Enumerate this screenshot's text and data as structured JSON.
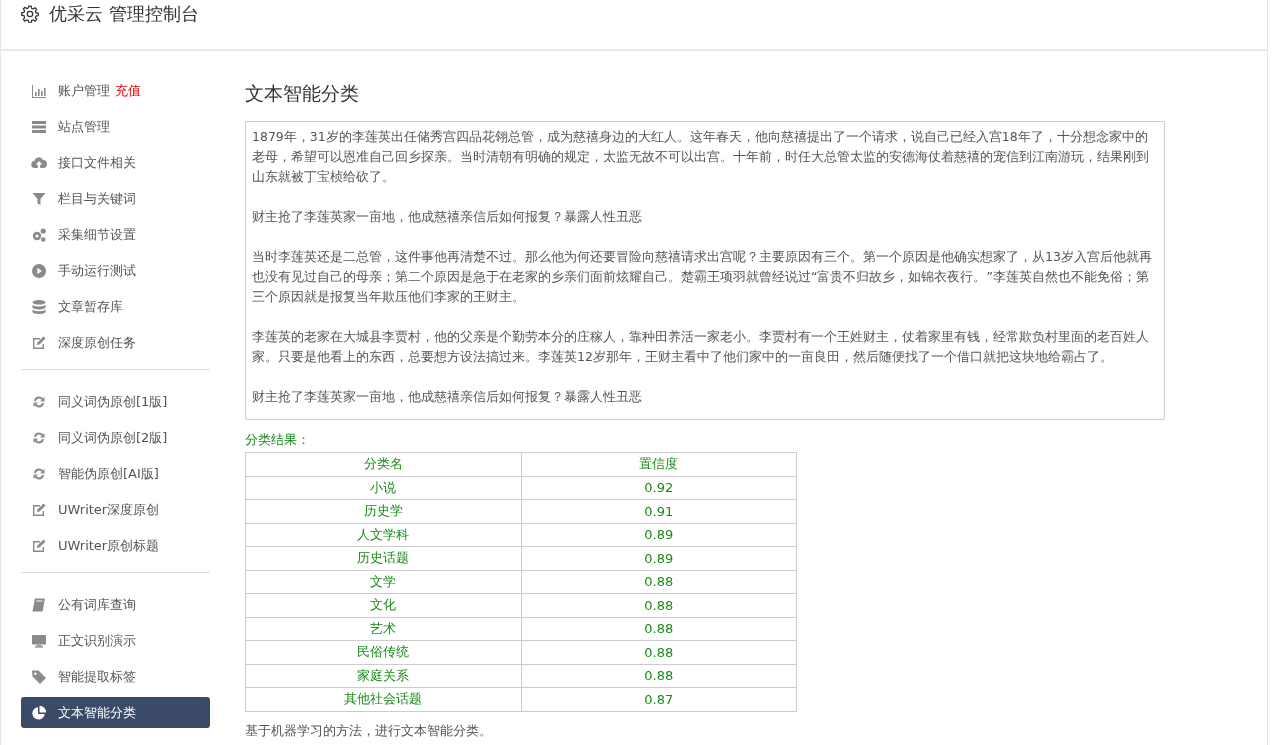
{
  "header": {
    "title": "优采云 管理控制台"
  },
  "sidebar": {
    "sections": [
      {
        "items": [
          {
            "label": "账户管理",
            "badge": "充值",
            "selected": false
          },
          {
            "label": "站点管理",
            "selected": false
          },
          {
            "label": "接口文件相关",
            "selected": false
          },
          {
            "label": "栏目与关键词",
            "selected": false
          },
          {
            "label": "采集细节设置",
            "selected": false
          },
          {
            "label": "手动运行测试",
            "selected": false
          },
          {
            "label": "文章暂存库",
            "selected": false
          },
          {
            "label": "深度原创任务",
            "selected": false
          }
        ]
      },
      {
        "items": [
          {
            "label": "同义词伪原创[1版]",
            "selected": false
          },
          {
            "label": "同义词伪原创[2版]",
            "selected": false
          },
          {
            "label": "智能伪原创[AI版]",
            "selected": false
          },
          {
            "label": "UWriter深度原创",
            "selected": false
          },
          {
            "label": "UWriter原创标题",
            "selected": false
          }
        ]
      },
      {
        "items": [
          {
            "label": "公有词库查询",
            "selected": false
          },
          {
            "label": "正文识别演示",
            "selected": false
          },
          {
            "label": "智能提取标签",
            "selected": false
          },
          {
            "label": "文本智能分类",
            "selected": true
          }
        ]
      }
    ]
  },
  "main": {
    "title": "文本智能分类",
    "text_input": {
      "paragraphs": [
        "1879年，31岁的李莲英出任储秀宫四品花翎总管，成为慈禧身边的大红人。这年春天，他向慈禧提出了一个请求，说自己已经入宫18年了，十分想念家中的老母，希望可以恩准自己回乡探亲。当时清朝有明确的规定，太监无故不可以出宫。十年前，时任大总管太监的安德海仗着慈禧的宠信到江南游玩，结果刚到山东就被丁宝桢给砍了。",
        "财主抢了李莲英家一亩地，他成慈禧亲信后如何报复？暴露人性丑恶",
        "当时李莲英还是二总管，这件事他再清楚不过。那么他为何还要冒险向慈禧请求出宫呢？主要原因有三个。第一个原因是他确实想家了，从13岁入宫后他就再也没有见过自己的母亲；第二个原因是急于在老家的乡亲们面前炫耀自己。楚霸王项羽就曾经说过“富贵不归故乡，如锦衣夜行。”李莲英自然也不能免俗；第三个原因就是报复当年欺压他们李家的王财主。",
        "李莲英的老家在大城县李贾村，他的父亲是个勤劳本分的庄稼人，靠种田养活一家老小。李贾村有一个王姓财主，仗着家里有钱，经常欺负村里面的老百姓人家。只要是他看上的东西，总要想方设法搞过来。李莲英12岁那年，王财主看中了他们家中的一亩良田，然后随便找了一个借口就把这块地给霸占了。",
        "财主抢了李莲英家一亩地，他成慈禧亲信后如何报复？暴露人性丑恶"
      ]
    },
    "result_label": "分类结果：",
    "table": {
      "columns": [
        "分类名",
        "置信度"
      ],
      "rows": [
        [
          "小说",
          "0.92"
        ],
        [
          "历史学",
          "0.91"
        ],
        [
          "人文学科",
          "0.89"
        ],
        [
          "历史话题",
          "0.89"
        ],
        [
          "文学",
          "0.88"
        ],
        [
          "文化",
          "0.88"
        ],
        [
          "艺术",
          "0.88"
        ],
        [
          "民俗传统",
          "0.88"
        ],
        [
          "家庭关系",
          "0.88"
        ],
        [
          "其他社会话题",
          "0.87"
        ]
      ]
    },
    "footnote": "基于机器学习的方法，进行文本智能分类。"
  }
}
